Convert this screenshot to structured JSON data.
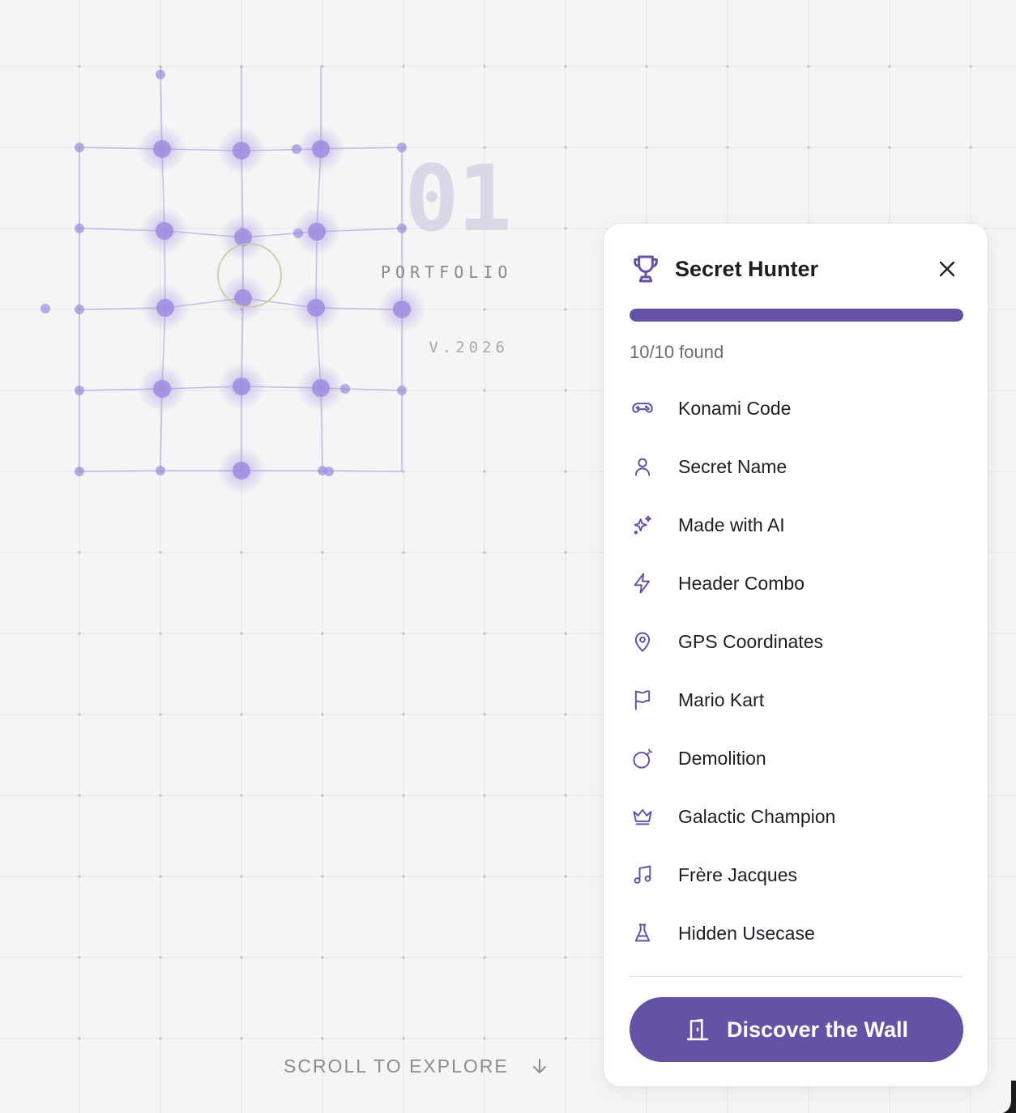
{
  "colors": {
    "accent": "#6552a7",
    "accent_light": "#9d8ce0",
    "grid_line": "#e6e4e6",
    "grid_dot": "#cfccd2"
  },
  "hero": {
    "number": "01",
    "label": "PORTFOLIO",
    "version": "V.2026"
  },
  "scroll_hint": {
    "label": "SCROLL TO EXPLORE",
    "icon": "arrow-down-icon"
  },
  "panel": {
    "title": "Secret Hunter",
    "title_icon": "trophy-icon",
    "close_icon": "close-icon",
    "progress": {
      "found": 10,
      "total": 10,
      "fraction": 1.0,
      "text": "10/10 found"
    },
    "items": [
      {
        "label": "Konami Code",
        "icon": "gamepad-icon"
      },
      {
        "label": "Secret Name",
        "icon": "user-icon"
      },
      {
        "label": "Made with AI",
        "icon": "sparkles-icon"
      },
      {
        "label": "Header Combo",
        "icon": "lightning-icon"
      },
      {
        "label": "GPS Coordinates",
        "icon": "map-pin-icon"
      },
      {
        "label": "Mario Kart",
        "icon": "flag-icon"
      },
      {
        "label": "Demolition",
        "icon": "bomb-icon"
      },
      {
        "label": "Galactic Champion",
        "icon": "crown-icon"
      },
      {
        "label": "Frère Jacques",
        "icon": "music-icon"
      },
      {
        "label": "Hidden Usecase",
        "icon": "flask-icon"
      }
    ],
    "cta": {
      "label": "Discover the Wall",
      "icon": "door-icon"
    }
  }
}
